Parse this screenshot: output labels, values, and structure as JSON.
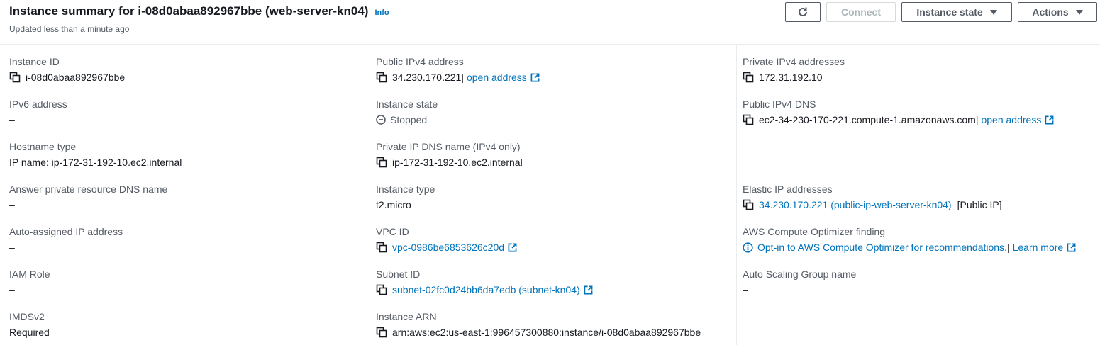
{
  "header": {
    "title": "Instance summary for i-08d0abaa892967bbe (web-server-kn04)",
    "info": "Info",
    "subtitle": "Updated less than a minute ago",
    "connect": "Connect",
    "instance_state": "Instance state",
    "actions": "Actions"
  },
  "fields": {
    "instance_id": {
      "label": "Instance ID",
      "value": "i-08d0abaa892967bbe"
    },
    "ipv6": {
      "label": "IPv6 address",
      "value": "–"
    },
    "hostname_type": {
      "label": "Hostname type",
      "value": "IP name: ip-172-31-192-10.ec2.internal"
    },
    "answer_dns": {
      "label": "Answer private resource DNS name",
      "value": "–"
    },
    "auto_ip": {
      "label": "Auto-assigned IP address",
      "value": "–"
    },
    "iam_role": {
      "label": "IAM Role",
      "value": "–"
    },
    "imdsv2": {
      "label": "IMDSv2",
      "value": "Required"
    },
    "public_ipv4": {
      "label": "Public IPv4 address",
      "value": "34.230.170.221",
      "sep": " |",
      "link": "open address"
    },
    "instance_state": {
      "label": "Instance state",
      "value": "Stopped"
    },
    "private_dns": {
      "label": "Private IP DNS name (IPv4 only)",
      "value": "ip-172-31-192-10.ec2.internal"
    },
    "instance_type": {
      "label": "Instance type",
      "value": "t2.micro"
    },
    "vpc_id": {
      "label": "VPC ID",
      "value": "vpc-0986be6853626c20d"
    },
    "subnet_id": {
      "label": "Subnet ID",
      "value": "subnet-02fc0d24bb6da7edb (subnet-kn04)"
    },
    "instance_arn": {
      "label": "Instance ARN",
      "value": "arn:aws:ec2:us-east-1:996457300880:instance/i-08d0abaa892967bbe"
    },
    "private_ipv4": {
      "label": "Private IPv4 addresses",
      "value": "172.31.192.10"
    },
    "public_dns": {
      "label": "Public IPv4 DNS",
      "value": "ec2-34-230-170-221.compute-1.amazonaws.com",
      "sep": "|",
      "link": "open address"
    },
    "elastic_ip": {
      "label": "Elastic IP addresses",
      "value": "34.230.170.221 (public-ip-web-server-kn04)",
      "suffix": "[Public IP]"
    },
    "optimizer": {
      "label": "AWS Compute Optimizer finding",
      "value": "Opt-in to AWS Compute Optimizer for recommendations.",
      "sep": " |",
      "link": "Learn more"
    },
    "asg_name": {
      "label": "Auto Scaling Group name",
      "value": "–"
    }
  },
  "colors": {
    "link": "#0073bb",
    "text": "#16191f",
    "label": "#545b64",
    "border": "#eaeded"
  },
  "icons": [
    "refresh-icon",
    "caret-down-icon",
    "copy-icon",
    "external-link-icon",
    "stopped-icon",
    "info-circle-icon"
  ]
}
